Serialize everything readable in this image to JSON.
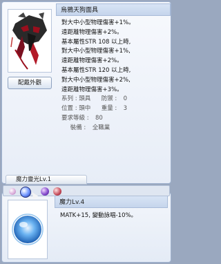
{
  "item": {
    "name": "烏鴉天狗面具",
    "appearance_button": "配戴外觀",
    "description": [
      "對大中小型物理傷害+1%。",
      "遠距離物理傷害+2%。",
      "基本屬性STR 108 以上時,",
      "對大中小型物理傷害+1%,",
      "遠距離物理傷害+2%。",
      "基本屬性STR 120 以上時,",
      "對大中小型物理傷害+2%,",
      "遠距離物理傷害+3%。"
    ],
    "stats": {
      "type_label": "系列 : 頭具",
      "defense_label": "防禦 :",
      "defense_value": "0",
      "position_label": "位置 : 頭中",
      "weight_label": "重量 :",
      "weight_value": "3",
      "level_label": "要求等級 :",
      "level_value": "80",
      "equip_label": "裝備 :",
      "equip_value": "全職業"
    },
    "tab_label": "魔力靈光Lv.1"
  },
  "card": {
    "name": "魔力Lv.4",
    "description": "MATK+15, 變動詠唱-10%。"
  },
  "colors": {
    "panel_border": "#9fb2cf",
    "title_bg": "#c5d5ec"
  }
}
